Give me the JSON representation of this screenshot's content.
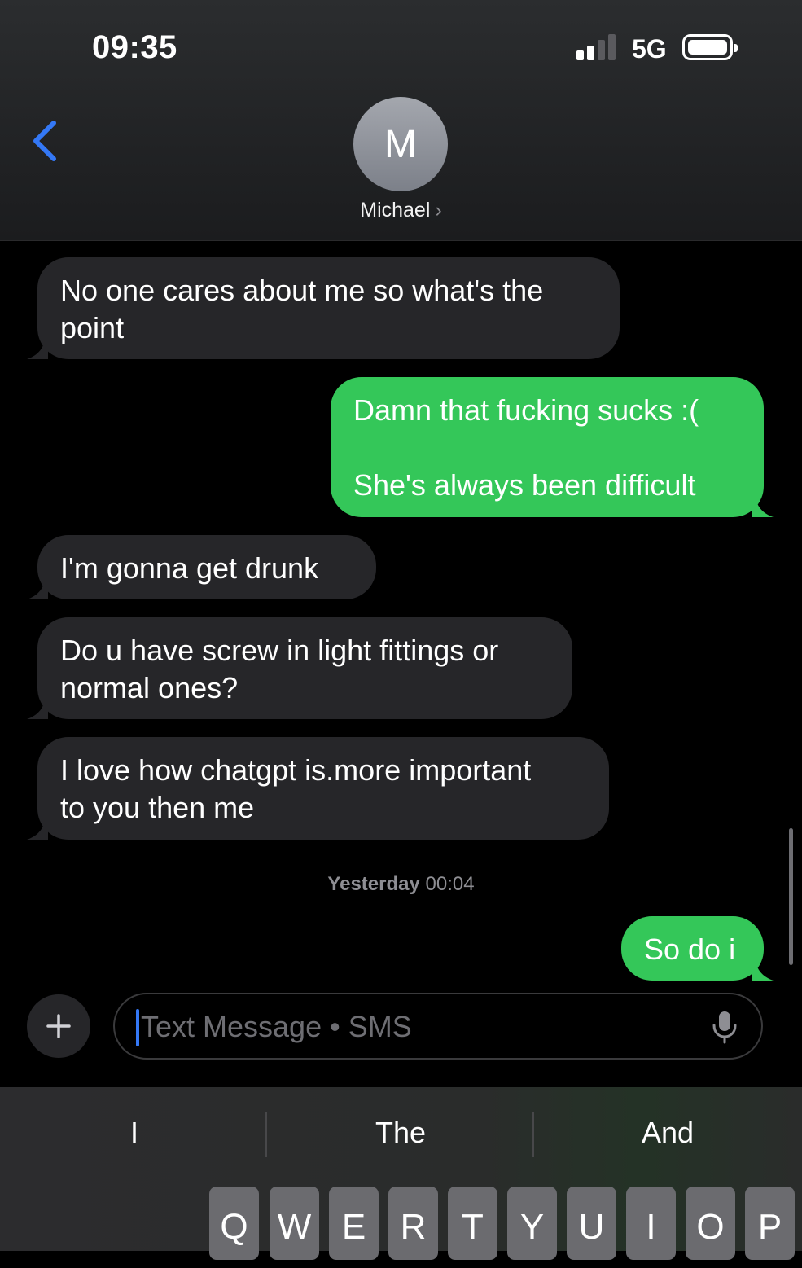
{
  "status_bar": {
    "time": "09:35",
    "network": "5G"
  },
  "header": {
    "avatar_initial": "M",
    "contact_name": "Michael",
    "chevron": "›"
  },
  "messages": [
    {
      "direction": "incoming",
      "text": "No one cares about me so what's the\npoint"
    },
    {
      "direction": "outgoing",
      "text": "Damn that fucking sucks :(\n\nShe's always been difficult"
    },
    {
      "direction": "incoming",
      "text": "I'm gonna get drunk"
    },
    {
      "direction": "incoming",
      "text": "Do u have screw in light fittings or\nnormal ones?"
    },
    {
      "direction": "incoming",
      "text": "I love how chatgpt is.more important\nto you then me"
    },
    {
      "direction": "outgoing",
      "text": "So do i"
    }
  ],
  "timestamp": {
    "day": "Yesterday",
    "time": "00:04"
  },
  "compose": {
    "placeholder": "Text Message • SMS"
  },
  "keyboard": {
    "suggestions": [
      "I",
      "The",
      "And"
    ],
    "top_row": [
      "Q",
      "W",
      "E",
      "R",
      "T",
      "Y",
      "U",
      "I",
      "O",
      "P"
    ]
  },
  "colors": {
    "incoming_bubble": "#262629",
    "outgoing_bubble": "#34c759",
    "accent": "#3478f6"
  },
  "icons": [
    "back-chevron-icon",
    "cellular-signal-icon",
    "battery-icon",
    "plus-icon",
    "microphone-icon"
  ]
}
